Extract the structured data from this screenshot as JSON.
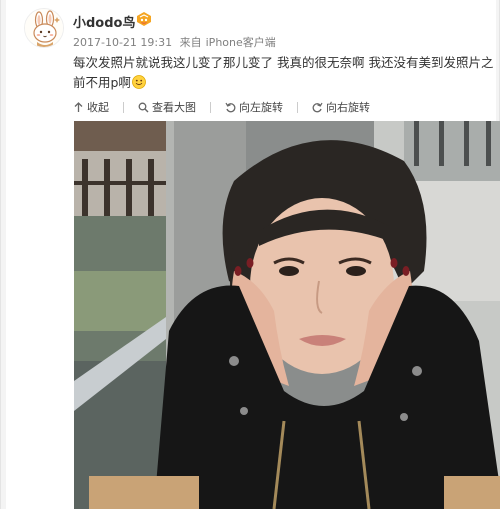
{
  "post": {
    "username": "小dodo鸟",
    "timestamp": "2017-10-21 19:31",
    "source_prefix": "来自",
    "source": "iPhone客户端",
    "content": "每次发照片就说我这儿变了那儿变了 我真的很无奈啊 我还没有美到发照片之前不用p啊",
    "emoji": "smile-emoji-icon"
  },
  "toolbar": {
    "collapse_label": "收起",
    "view_large_label": "查看大图",
    "rotate_left_label": "向左旋转",
    "rotate_right_label": "向右旋转"
  },
  "icons": {
    "collapse": "arrow-up-icon",
    "view_large": "magnifier-icon",
    "rotate_left": "rotate-left-icon",
    "rotate_right": "rotate-right-icon"
  },
  "colors": {
    "accent": "#eb7350",
    "meta": "#808080",
    "text": "#333333"
  }
}
